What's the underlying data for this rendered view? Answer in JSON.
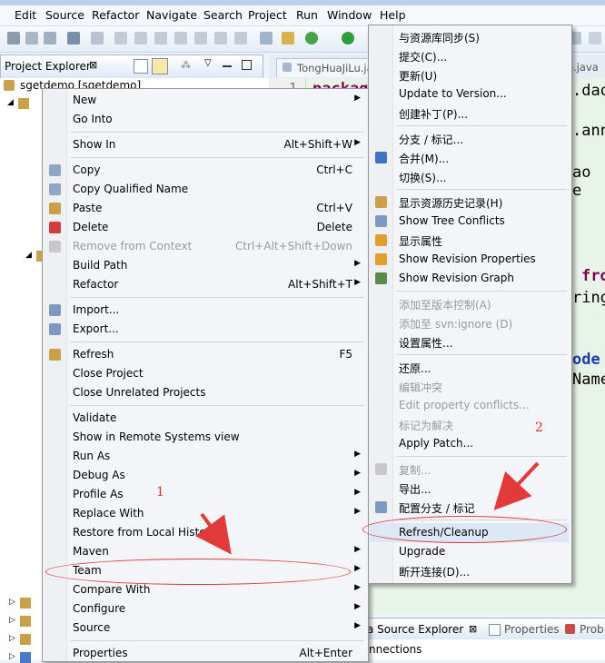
{
  "menubar": [
    "Edit",
    "Source",
    "Refactor",
    "Navigate",
    "Search",
    "Project",
    "Run",
    "Window",
    "Help"
  ],
  "project_explorer": {
    "tab_label": "Project Explorer",
    "tree_root": "sgetdemo [sgetdemo]"
  },
  "editor": {
    "tab1": "TongHuaJiLu.java",
    "tab2": "e.java",
    "line_number": "1",
    "code_fragments": [
      "packag",
      ".dao",
      ".ann",
      "ao e",
      "fro",
      "ring",
      "ode",
      "Name"
    ]
  },
  "bottom_panel": {
    "tab_source_explorer": "a Source Explorer",
    "tab_properties": "Properties",
    "tab_problems": "Prob",
    "content": "nnections"
  },
  "context_menu": {
    "groups": [
      [
        {
          "label": "New",
          "shortcut": "",
          "submenu": true,
          "disabled": false
        },
        {
          "label": "Go Into",
          "shortcut": "",
          "submenu": false,
          "disabled": false
        }
      ],
      [
        {
          "label": "Show In",
          "shortcut": "Alt+Shift+W",
          "submenu": true,
          "disabled": false
        }
      ],
      [
        {
          "label": "Copy",
          "shortcut": "Ctrl+C",
          "submenu": false,
          "disabled": false,
          "icon": "copy-icon"
        },
        {
          "label": "Copy Qualified Name",
          "shortcut": "",
          "submenu": false,
          "disabled": false,
          "icon": "copy-qualified-name-icon"
        },
        {
          "label": "Paste",
          "shortcut": "Ctrl+V",
          "submenu": false,
          "disabled": false,
          "icon": "paste-icon"
        },
        {
          "label": "Delete",
          "shortcut": "Delete",
          "submenu": false,
          "disabled": false,
          "icon": "delete-icon"
        },
        {
          "label": "Remove from Context",
          "shortcut": "Ctrl+Alt+Shift+Down",
          "submenu": false,
          "disabled": true,
          "icon": "remove-context-icon"
        },
        {
          "label": "Build Path",
          "shortcut": "",
          "submenu": true,
          "disabled": false
        },
        {
          "label": "Refactor",
          "shortcut": "Alt+Shift+T",
          "submenu": true,
          "disabled": false
        }
      ],
      [
        {
          "label": "Import...",
          "shortcut": "",
          "submenu": false,
          "disabled": false,
          "icon": "import-icon"
        },
        {
          "label": "Export...",
          "shortcut": "",
          "submenu": false,
          "disabled": false,
          "icon": "export-icon"
        }
      ],
      [
        {
          "label": "Refresh",
          "shortcut": "F5",
          "submenu": false,
          "disabled": false,
          "icon": "refresh-icon"
        },
        {
          "label": "Close Project",
          "shortcut": "",
          "submenu": false,
          "disabled": false
        },
        {
          "label": "Close Unrelated Projects",
          "shortcut": "",
          "submenu": false,
          "disabled": false
        }
      ],
      [
        {
          "label": "Validate",
          "shortcut": "",
          "submenu": false,
          "disabled": false
        },
        {
          "label": "Show in Remote Systems view",
          "shortcut": "",
          "submenu": false,
          "disabled": false
        },
        {
          "label": "Run As",
          "shortcut": "",
          "submenu": true,
          "disabled": false
        },
        {
          "label": "Debug As",
          "shortcut": "",
          "submenu": true,
          "disabled": false
        },
        {
          "label": "Profile As",
          "shortcut": "",
          "submenu": true,
          "disabled": false
        },
        {
          "label": "Replace With",
          "shortcut": "",
          "submenu": true,
          "disabled": false
        },
        {
          "label": "Restore from Local History...",
          "shortcut": "",
          "submenu": false,
          "disabled": false
        },
        {
          "label": "Maven",
          "shortcut": "",
          "submenu": true,
          "disabled": false
        },
        {
          "label": "Team",
          "shortcut": "",
          "submenu": true,
          "disabled": false,
          "highlighted": true
        },
        {
          "label": "Compare With",
          "shortcut": "",
          "submenu": true,
          "disabled": false
        },
        {
          "label": "Configure",
          "shortcut": "",
          "submenu": true,
          "disabled": false
        },
        {
          "label": "Source",
          "shortcut": "",
          "submenu": true,
          "disabled": false
        }
      ],
      [
        {
          "label": "Properties",
          "shortcut": "Alt+Enter",
          "submenu": false,
          "disabled": false
        }
      ]
    ]
  },
  "team_submenu": {
    "groups": [
      [
        {
          "label": "与资源库同步(S)",
          "disabled": false
        },
        {
          "label": "提交(C)...",
          "disabled": false
        },
        {
          "label": "更新(U)",
          "disabled": false
        },
        {
          "label": "Update to Version...",
          "disabled": false
        },
        {
          "label": "创建补丁(P)...",
          "disabled": false
        }
      ],
      [
        {
          "label": "分支 / 标记...",
          "disabled": false
        },
        {
          "label": "合并(M)...",
          "disabled": false,
          "icon": "merge-icon"
        },
        {
          "label": "切换(S)...",
          "disabled": false
        }
      ],
      [
        {
          "label": "显示资源历史记录(H)",
          "disabled": false,
          "icon": "history-icon"
        },
        {
          "label": "Show Tree Conflicts",
          "disabled": false,
          "icon": "tree-conflicts-icon"
        },
        {
          "label": "显示属性",
          "disabled": false,
          "icon": "properties-icon"
        },
        {
          "label": "Show Revision Properties",
          "disabled": false,
          "icon": "revision-properties-icon"
        },
        {
          "label": "Show Revision Graph",
          "disabled": false,
          "icon": "revision-graph-icon"
        }
      ],
      [
        {
          "label": "添加至版本控制(A)",
          "disabled": true
        },
        {
          "label": "添加至 svn:ignore (D)",
          "disabled": true
        },
        {
          "label": "设置属性...",
          "disabled": false
        }
      ],
      [
        {
          "label": "还原...",
          "disabled": false
        },
        {
          "label": "编辑冲突",
          "disabled": true
        },
        {
          "label": "Edit property conflicts...",
          "disabled": true
        },
        {
          "label": "标记为解决",
          "disabled": true
        },
        {
          "label": "Apply Patch...",
          "disabled": false
        }
      ],
      [
        {
          "label": "复制...",
          "disabled": true,
          "icon": "copy-icon"
        },
        {
          "label": "导出...",
          "disabled": false
        },
        {
          "label": "配置分支 / 标记",
          "disabled": false,
          "icon": "configure-branches-icon"
        }
      ],
      [
        {
          "label": "Refresh/Cleanup",
          "disabled": false,
          "highlighted": true
        },
        {
          "label": "Upgrade",
          "disabled": false
        },
        {
          "label": "断开连接(D)...",
          "disabled": false
        }
      ]
    ]
  },
  "annotations": {
    "step1": "1",
    "step2": "2",
    "color": "#e23a3a"
  },
  "colors": {
    "menu_bg": "#f3f5f8",
    "disabled_text": "#9a9a9a",
    "editor_bg": "#e8f4e8"
  }
}
